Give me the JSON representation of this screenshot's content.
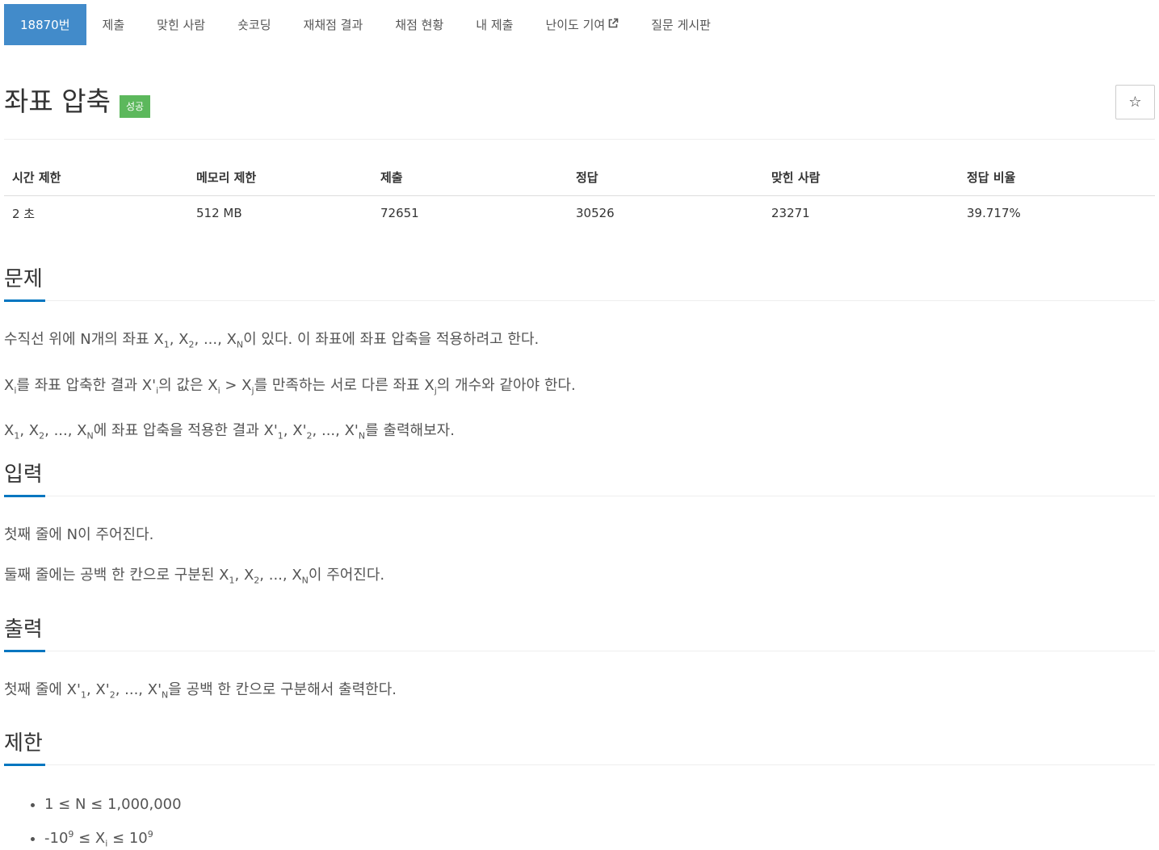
{
  "nav": {
    "problem_number": "18870번",
    "submit": "제출",
    "solvers": "맞힌 사람",
    "short_coding": "숏코딩",
    "rejudge": "재채점 결과",
    "status": "채점 현황",
    "my_submissions": "내 제출",
    "difficulty": "난이도 기여",
    "qna": "질문 게시판"
  },
  "problem": {
    "title": "좌표 압축",
    "badge": "성공",
    "badge_color": "#5cb85c",
    "accent_color": "#428bca"
  },
  "info_table": {
    "headers": [
      "시간 제한",
      "메모리 제한",
      "제출",
      "정답",
      "맞힌 사람",
      "정답 비율"
    ],
    "row": [
      "2 초",
      "512 MB",
      "72651",
      "30526",
      "23271",
      "39.717%"
    ]
  },
  "sections": {
    "description": {
      "heading": "문제",
      "p1_a": "수직선 위에 N개의 좌표 X",
      "p1_s1": "1",
      "p1_b": ", X",
      "p1_s2": "2",
      "p1_c": ", ..., X",
      "p1_sN": "N",
      "p1_d": "이 있다. 이 좌표에 좌표 압축을 적용하려고 한다.",
      "p2_a": "X",
      "p2_s1": "i",
      "p2_b": "를 좌표 압축한 결과 X'",
      "p2_s2": "i",
      "p2_c": "의 값은 X",
      "p2_s3": "i",
      "p2_d": " > X",
      "p2_s4": "j",
      "p2_e": "를 만족하는 서로 다른 좌표 X",
      "p2_s5": "j",
      "p2_f": "의 개수와 같아야 한다.",
      "p3_a": "X",
      "p3_s1": "1",
      "p3_b": ", X",
      "p3_s2": "2",
      "p3_c": ", ..., X",
      "p3_s3": "N",
      "p3_d": "에 좌표 압축을 적용한 결과 X'",
      "p3_s4": "1",
      "p3_e": ", X'",
      "p3_s5": "2",
      "p3_f": ", ..., X'",
      "p3_s6": "N",
      "p3_g": "를 출력해보자."
    },
    "input": {
      "heading": "입력",
      "p1": "첫째 줄에 N이 주어진다.",
      "p2_a": "둘째 줄에는 공백 한 칸으로 구분된 X",
      "p2_s1": "1",
      "p2_b": ", X",
      "p2_s2": "2",
      "p2_c": ", ..., X",
      "p2_s3": "N",
      "p2_d": "이 주어진다."
    },
    "output": {
      "heading": "출력",
      "p1_a": "첫째 줄에 X'",
      "p1_s1": "1",
      "p1_b": ", X'",
      "p1_s2": "2",
      "p1_c": ", ..., X'",
      "p1_s3": "N",
      "p1_d": "을 공백 한 칸으로 구분해서 출력한다."
    },
    "limits": {
      "heading": "제한",
      "item1": "1 ≤ N ≤ 1,000,000",
      "item2_a": "-10",
      "item2_s1": "9",
      "item2_b": " ≤ X",
      "item2_s2": "i",
      "item2_c": " ≤ 10",
      "item2_s3": "9"
    }
  }
}
